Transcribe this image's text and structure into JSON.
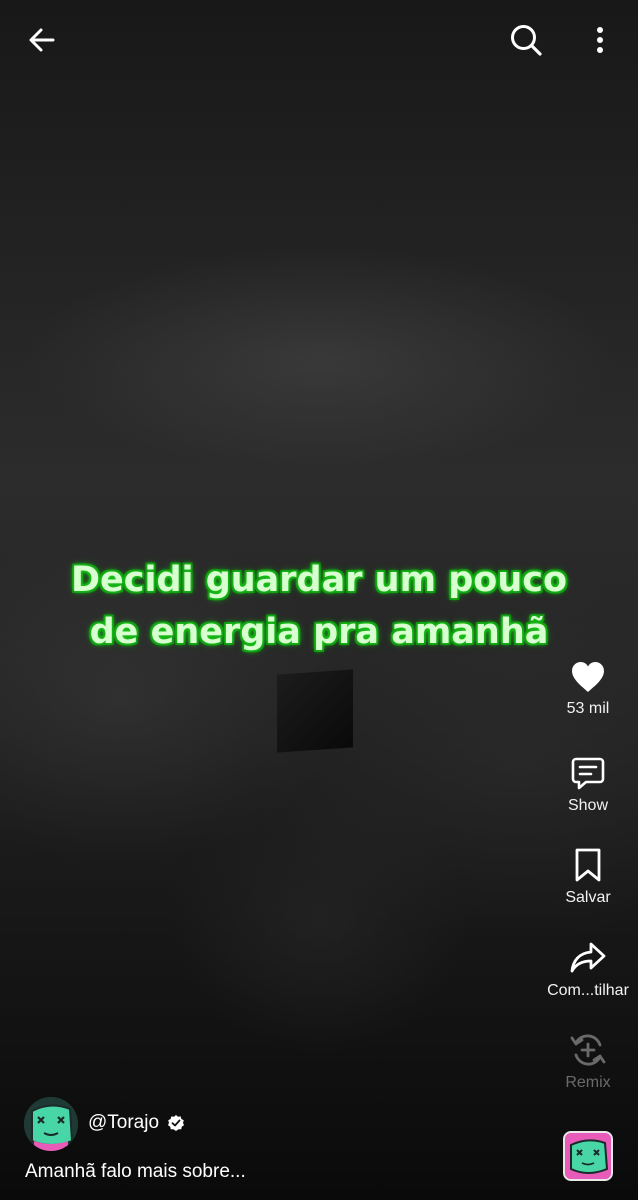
{
  "caption": {
    "line1": "Decidi guardar um pouco",
    "line2": "de energia pra amanhã"
  },
  "top_bar": {
    "back_icon": "arrow-left-icon",
    "search_icon": "search-icon",
    "more_icon": "more-vertical-icon"
  },
  "actions": {
    "like": {
      "icon": "heart-icon",
      "label": "53 mil"
    },
    "comments": {
      "icon": "comment-icon",
      "label": "Show"
    },
    "save": {
      "icon": "bookmark-icon",
      "label": "Salvar"
    },
    "share": {
      "icon": "share-icon",
      "label": "Com...tilhar"
    },
    "remix": {
      "icon": "remix-icon",
      "label": "Remix"
    }
  },
  "author": {
    "handle": "@Torajo",
    "verified_icon": "verified-badge-icon"
  },
  "description": "Amanhã falo mais sobre...",
  "colors": {
    "caption_glow": "#1fc61f",
    "caption_text": "#d8ffcf",
    "disc_background": "#e85bb8",
    "avatar_mint": "#49d6a6"
  }
}
